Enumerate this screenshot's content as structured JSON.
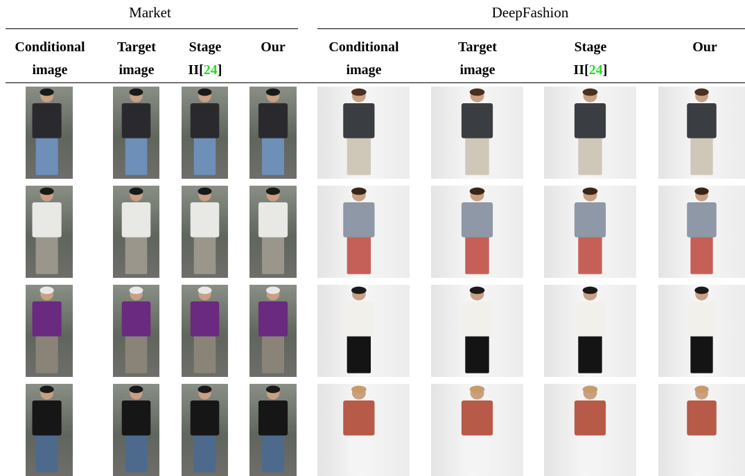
{
  "groups": {
    "market": "Market",
    "deepfashion": "DeepFashion"
  },
  "columns": {
    "market": [
      {
        "line1": "Conditional",
        "line2": "image"
      },
      {
        "line1": "Target",
        "line2": "image"
      },
      {
        "line1": "Stage",
        "line2_prefix": "II[",
        "line2_ref": "24",
        "line2_suffix": "]"
      },
      {
        "line1": "Our",
        "line2": ""
      }
    ],
    "deepfashion": [
      {
        "line1": "Conditional",
        "line2": "image"
      },
      {
        "line1": "Target",
        "line2": "image"
      },
      {
        "line1": "Stage",
        "line2_prefix": "II[",
        "line2_ref": "24",
        "line2_suffix": "]"
      },
      {
        "line1": "Our",
        "line2": ""
      }
    ]
  },
  "rows": [
    {
      "market": {
        "shirt": "#2a2a2e",
        "pants": "#6d8fb8",
        "hair": "#1a1a1a"
      },
      "fashion": {
        "shirt": "#3a3d42",
        "pants": "#cfc8b8",
        "hair": "#4a3020"
      }
    },
    {
      "market": {
        "shirt": "#e8e8e4",
        "pants": "#9a968c",
        "hair": "#1a1a1a"
      },
      "fashion": {
        "shirt": "#8f98a6",
        "pants": "#c56058",
        "hair": "#3a2618"
      }
    },
    {
      "market": {
        "shirt": "#6a2a80",
        "pants": "#8a8478",
        "hair": "#e8e8e8"
      },
      "fashion": {
        "shirt": "#f2f0ea",
        "pants": "#141414",
        "hair": "#1a1a1a"
      }
    },
    {
      "market": {
        "shirt": "#161616",
        "pants": "#4d6a8c",
        "hair": "#1a1a1a"
      },
      "fashion": {
        "shirt": "#b85a48",
        "pants": "#f4f4f4",
        "hair": "#c89a68"
      }
    }
  ]
}
